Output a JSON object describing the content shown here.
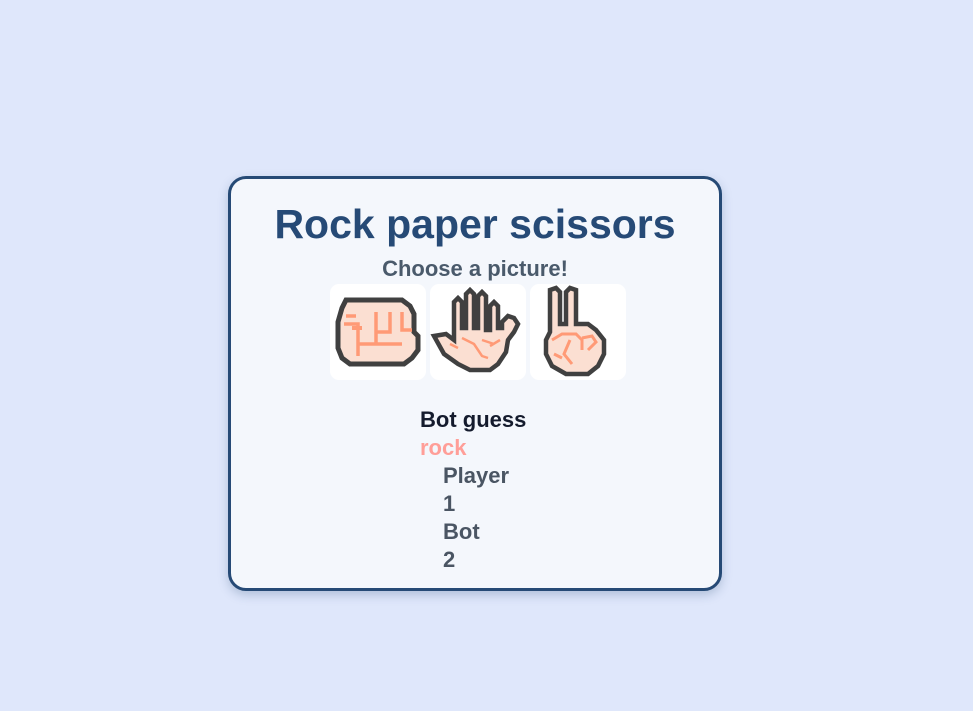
{
  "game": {
    "title": "Rock paper scissors",
    "subtitle": "Choose a picture!",
    "choices": [
      {
        "label": "rock",
        "icon": "rock-fist-icon"
      },
      {
        "label": "paper",
        "icon": "paper-hand-icon"
      },
      {
        "label": "scissors",
        "icon": "scissors-fingers-icon"
      }
    ]
  },
  "result": {
    "bot_guess_label": "Bot guess",
    "bot_guess_value": "rock",
    "player_label": "Player",
    "player_score": "1",
    "bot_label": "Bot",
    "bot_score": "2"
  },
  "colors": {
    "page_background": "#dfe7fb",
    "card_border": "#264a76",
    "title": "#264a76",
    "bot_guess_value": "#ff9e98",
    "skin": "#fbdfd2",
    "skin_line": "#ff9a76",
    "outline": "#404040"
  }
}
